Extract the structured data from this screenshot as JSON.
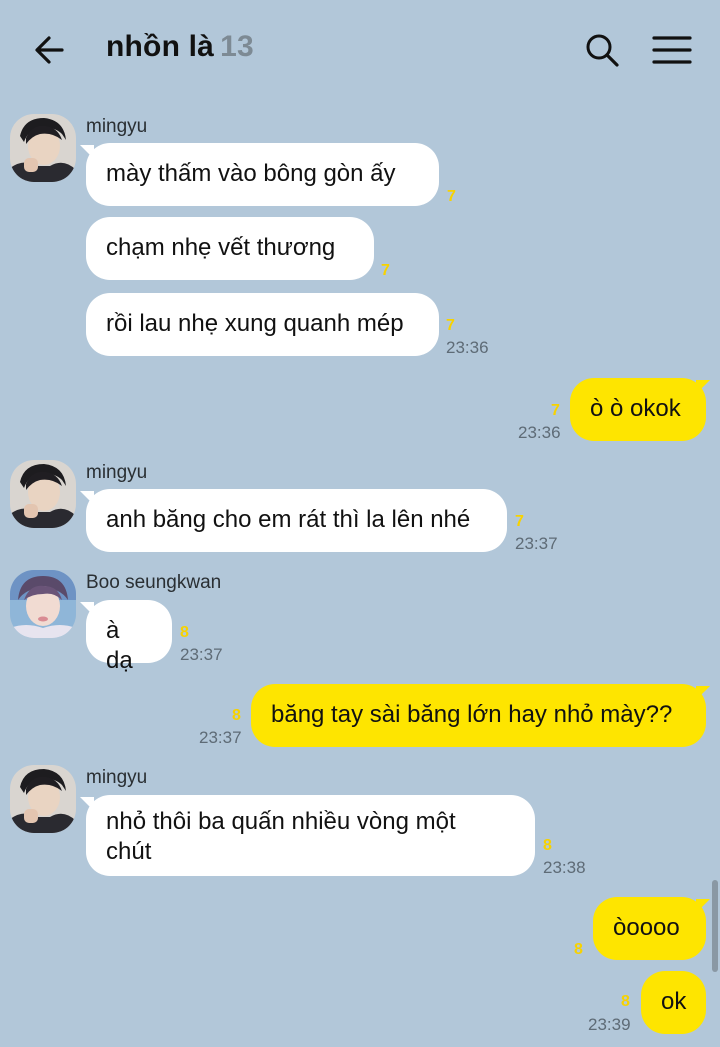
{
  "header": {
    "title": "nhồn là",
    "member_count": "13",
    "back_icon": "arrow-left-icon",
    "search_icon": "search-icon",
    "menu_icon": "hamburger-menu-icon"
  },
  "colors": {
    "background": "#b2c7d9",
    "incoming_bubble": "#ffffff",
    "outgoing_bubble": "#fee500",
    "unread_count": "#f7d200"
  },
  "messages": [
    {
      "sender": "mingyu",
      "text": "mày thấm vào bông gòn ấy",
      "unread": "7",
      "time": ""
    },
    {
      "text": "chạm nhẹ vết thương",
      "unread": "7",
      "time": ""
    },
    {
      "text": "rồi lau nhẹ xung quanh mép",
      "unread": "7",
      "time": "23:36"
    },
    {
      "text": "ò ò okok",
      "unread": "7",
      "time": "23:36"
    },
    {
      "sender": "mingyu",
      "text": "anh băng cho em rát thì la lên nhé",
      "unread": "7",
      "time": "23:37"
    },
    {
      "sender": "Boo seungkwan",
      "text": "à dạ",
      "unread": "8",
      "time": "23:37"
    },
    {
      "text": "băng tay sài băng lớn hay nhỏ mày??",
      "unread": "8",
      "time": "23:37"
    },
    {
      "sender": "mingyu",
      "text": "nhỏ thôi ba quấn nhiều vòng một chút",
      "unread": "8",
      "time": "23:38"
    },
    {
      "text": "òoooo",
      "unread": "8",
      "time": ""
    },
    {
      "text": "ok",
      "unread": "8",
      "time": "23:39"
    }
  ]
}
